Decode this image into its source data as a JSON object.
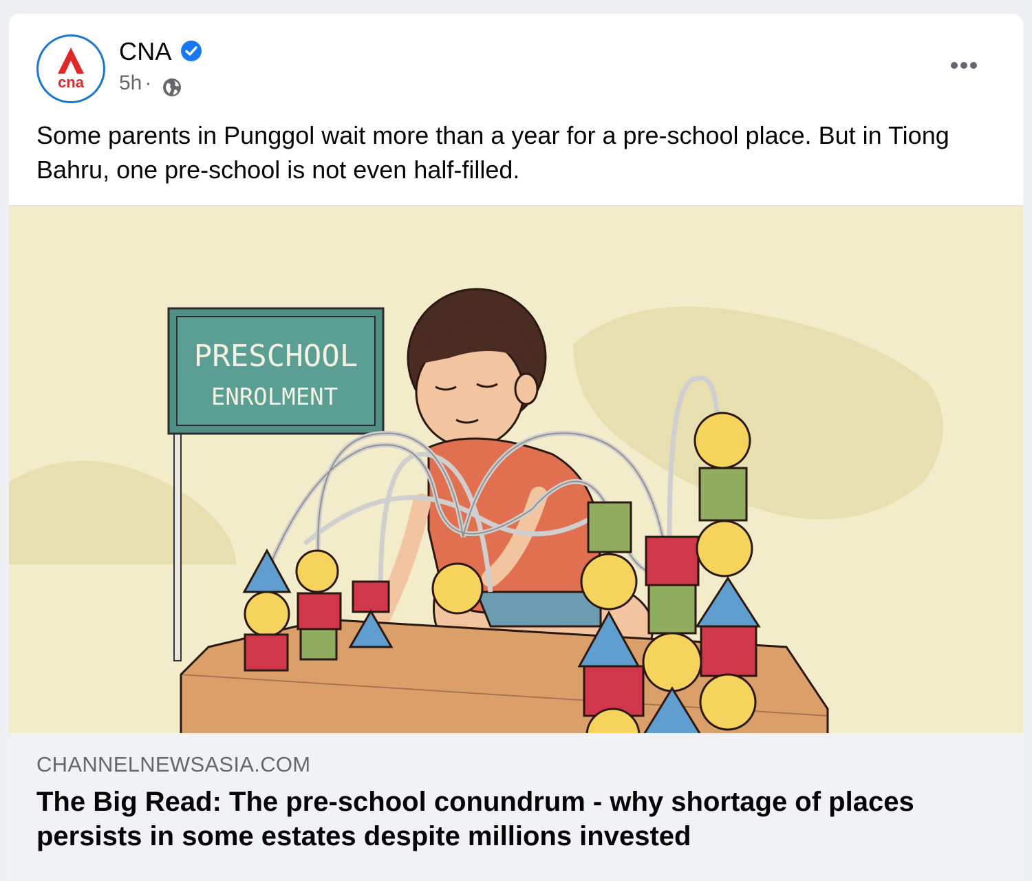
{
  "post": {
    "page_name": "CNA",
    "logo_text": "cna",
    "time": "5h",
    "separator": "·",
    "caption": "Some parents in Punggol wait more than a year for a pre-school place. But in Tiong Bahru, one pre-school is not even half-filled.",
    "icons": {
      "verified": "verified-badge-icon",
      "audience": "globe-icon",
      "menu": "more-options-icon"
    }
  },
  "image": {
    "sign_line1": "PRESCHOOL",
    "sign_line2": "ENROLMENT"
  },
  "link_preview": {
    "domain": "CHANNELNEWSASIA.COM",
    "headline": "The Big Read: The pre-school conundrum - why shortage of places persists in some estates despite millions invested"
  },
  "colors": {
    "brand_red": "#e02828",
    "verified_blue": "#1877f2",
    "avatar_ring": "#1976d2",
    "image_bg": "#f2ecca"
  }
}
